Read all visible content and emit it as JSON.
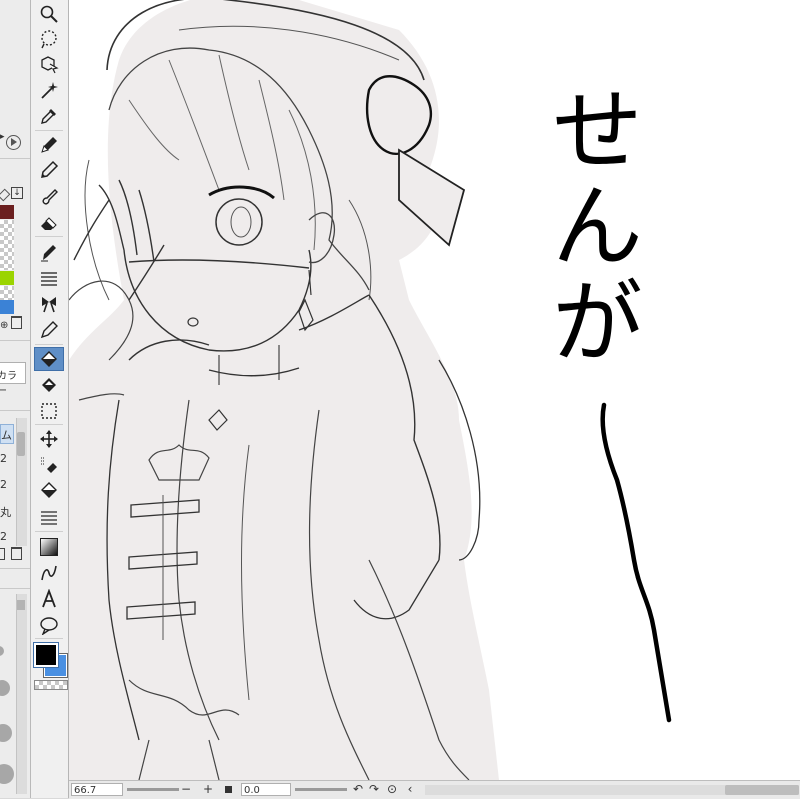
{
  "left_panel": {
    "color_mode_label": "カラー",
    "tab_label": "ム",
    "values": [
      "2",
      "2",
      "丸",
      "2"
    ]
  },
  "colors": {
    "main_color": "#000000",
    "sub_color": "#4a90e2",
    "swatch_brown": "#6b1f1f",
    "swatch_green": "#9bd400",
    "swatch_blue": "#3b82d6",
    "selected_tool": "#5f8fc7"
  },
  "tools": [
    "zoom-icon",
    "lasso-icon",
    "object-select-icon",
    "auto-select-wand-icon",
    "eyedropper-icon",
    "pen-icon",
    "pencil-icon",
    "brush-icon",
    "eraser-icon",
    "marker-icon",
    "ruler-lines-icon",
    "decoration-ribbon-icon",
    "correction-pen-icon",
    "fill-icon",
    "fill-eraser-icon",
    "selection-rect-icon",
    "move-icon",
    "layer-move-icon",
    "bucket-icon",
    "lines-icon",
    "gradient-icon",
    "vector-curve-icon",
    "text-icon",
    "speech-balloon-icon"
  ],
  "canvas": {
    "handwritten_text": "せんが"
  },
  "status_bar": {
    "zoom": "66.7",
    "zoom_out": "−",
    "zoom_in": "+",
    "angle": "0.0"
  }
}
